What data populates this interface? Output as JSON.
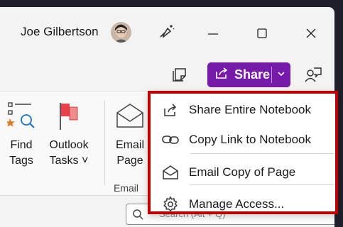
{
  "titlebar": {
    "user_name": "Joe Gilbertson"
  },
  "toolbar": {
    "share_label": "Share"
  },
  "ribbon": {
    "find_tags": [
      "Find",
      "Tags"
    ],
    "outlook_tasks": [
      "Outlook",
      "Tasks ˅"
    ],
    "email_page": [
      "Email",
      "Page"
    ],
    "email_group_label": "Email"
  },
  "search": {
    "placeholder": "Search (Alt + Q)"
  },
  "share_menu": {
    "items": [
      {
        "label": "Share Entire Notebook",
        "icon": "share-icon"
      },
      {
        "label": "Copy Link to Notebook",
        "icon": "link-icon"
      },
      {
        "label": "Email Copy of Page",
        "icon": "envelope-icon"
      },
      {
        "label": "Manage Access...",
        "icon": "gear-icon"
      }
    ]
  },
  "colors": {
    "share_accent": "#7719aa",
    "highlight_border": "#c00000"
  }
}
